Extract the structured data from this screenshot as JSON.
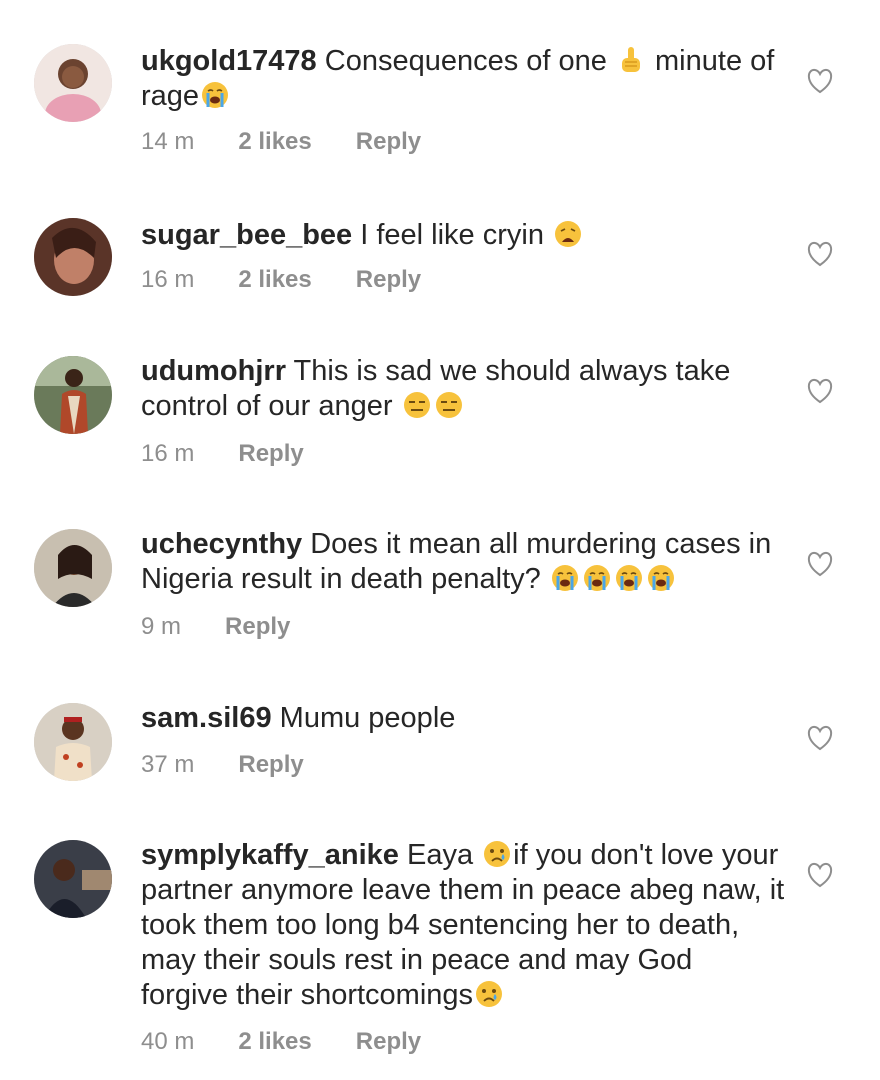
{
  "comments": [
    {
      "username": "ukgold17478",
      "text_before": "Consequences of one ",
      "text_mid": " minute of rage",
      "text_after": "",
      "time": "14 m",
      "likes": "2 likes",
      "reply": "Reply",
      "avatar_color": "#f1b9c4",
      "emojis": [
        "pointing-up-emoji",
        "loudly-crying-emoji"
      ]
    },
    {
      "username": "sugar_bee_bee",
      "text": "I feel like cryin ",
      "time": "16 m",
      "likes": "2 likes",
      "reply": "Reply",
      "avatar_color": "#7a4a3a",
      "emojis": [
        "weary-face-emoji"
      ]
    },
    {
      "username": "udumohjrr",
      "text": "This is sad we should always take control of our anger ",
      "time": "16 m",
      "reply": "Reply",
      "avatar_color": "#5a6b4a",
      "emojis": [
        "expressionless-face-emoji",
        "expressionless-face-emoji"
      ]
    },
    {
      "username": "uchecynthy",
      "text": "Does it mean all murdering cases in Nigeria result in death penalty? ",
      "time": "9 m",
      "reply": "Reply",
      "avatar_color": "#8a7a68",
      "emojis": [
        "loudly-crying-emoji",
        "loudly-crying-emoji",
        "loudly-crying-emoji",
        "loudly-crying-emoji"
      ]
    },
    {
      "username": "sam.sil69",
      "text": "Mumu people",
      "time": "37 m",
      "reply": "Reply",
      "avatar_color": "#9a8878",
      "emojis": []
    },
    {
      "username": "symplykaffy_anike",
      "text_before": "Eaya ",
      "text_after": "if you don't love your partner anymore leave them in peace abeg naw, it took them too long b4 sentencing her to death, may their souls rest in peace and may God forgive their shortcomings",
      "time": "40 m",
      "likes": "2 likes",
      "reply": "Reply",
      "avatar_color": "#2a2e3a",
      "emojis": [
        "crying-face-emoji",
        "crying-face-emoji"
      ]
    }
  ],
  "colors": {
    "text": "#262626",
    "meta": "#8e8e8e",
    "heart_stroke": "#8e8e8e",
    "emoji_yellow": "#f7c23c",
    "tear_blue": "#4aa6e8"
  }
}
